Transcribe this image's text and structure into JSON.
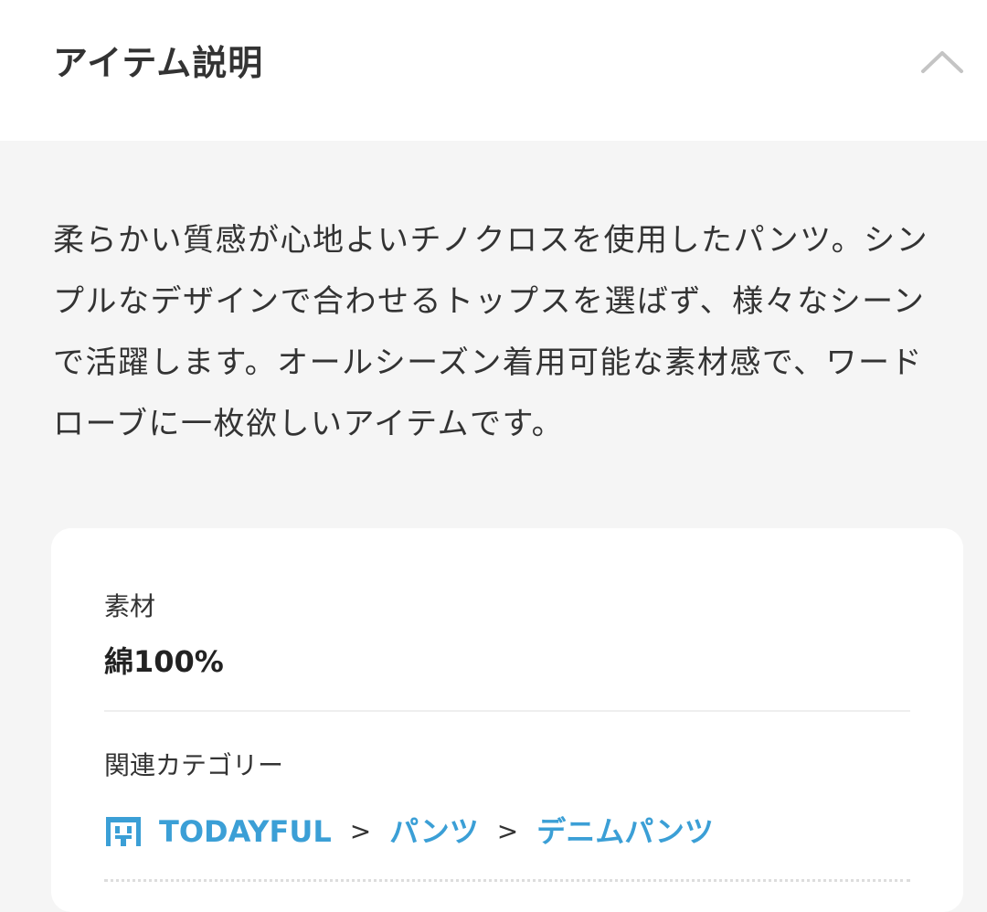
{
  "header": {
    "title": "アイテム説明",
    "collapse_icon": "chevron-up-icon"
  },
  "description": "柔らかい質感が心地よいチノクロスを使用したパンツ。シンプルなデザインで合わせるトップスを選ばず、様々なシーンで活躍します。オールシーズン着用可能な素材感で、ワードローブに一枚欲しいアイテムです。",
  "details": {
    "material_label": "素材",
    "material_value": "綿100%",
    "category_label": "関連カテゴリー",
    "breadcrumb": {
      "icon": "shop-icon",
      "items": [
        "TODAYFUL",
        "パンツ",
        "デニムパンツ"
      ],
      "separator": ">"
    }
  },
  "colors": {
    "link": "#3b9fd6",
    "background": "#f5f5f5",
    "card": "#ffffff",
    "text": "#333333"
  }
}
